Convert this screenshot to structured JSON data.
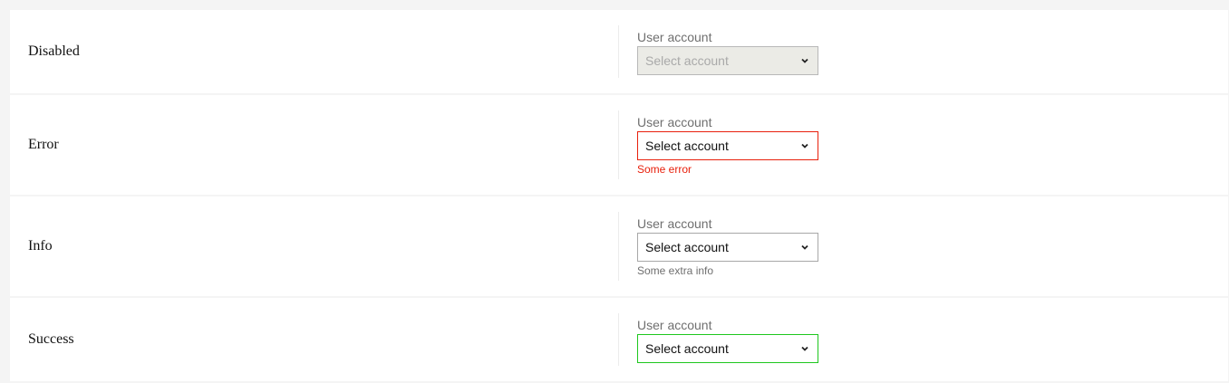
{
  "colors": {
    "error": "#e8200c",
    "success": "#1ec71e",
    "disabled_bg": "#ebebe6"
  },
  "rows": [
    {
      "title": "Disabled",
      "field_label": "User account",
      "placeholder": "Select account",
      "state": "disabled"
    },
    {
      "title": "Error",
      "field_label": "User account",
      "placeholder": "Select account",
      "state": "error",
      "message": "Some error"
    },
    {
      "title": "Info",
      "field_label": "User account",
      "placeholder": "Select account",
      "state": "info",
      "message": "Some extra info"
    },
    {
      "title": "Success",
      "field_label": "User account",
      "placeholder": "Select account",
      "state": "success"
    }
  ],
  "icons": {
    "dropdown": "chevron-down-icon"
  }
}
